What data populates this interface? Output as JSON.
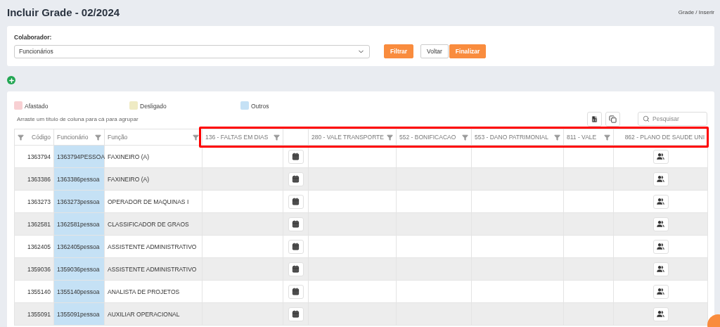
{
  "page": {
    "title": "Incluir Grade - 02/2024",
    "breadcrumb": "Grade / Inserir"
  },
  "filter": {
    "label": "Colaborador:",
    "value": "Funcionários",
    "buttons": [
      {
        "label": "Filtrar",
        "kind": "primary"
      },
      {
        "label": "Voltar",
        "kind": "plain"
      },
      {
        "label": "Finalizar",
        "kind": "primary"
      }
    ]
  },
  "legend": [
    {
      "label": "Afastado",
      "color": "#f8d0d3"
    },
    {
      "label": "Desligado",
      "color": "#efebc4"
    },
    {
      "label": "Outros",
      "color": "#c5e1f5"
    }
  ],
  "group_hint": "Arraste um título de coluna para cá para agrupar",
  "search": {
    "placeholder": "Pesquisar"
  },
  "columns": [
    {
      "label": "Código",
      "kind": "code",
      "filterable": true
    },
    {
      "label": "Funcionário",
      "kind": "employee",
      "filterable": true
    },
    {
      "label": "Função",
      "kind": "role",
      "filterable": true
    },
    {
      "label": "136 - FALTAS EM DIAS",
      "kind": "empty",
      "filterable": true
    },
    {
      "kind": "calendar",
      "filterable": false
    },
    {
      "label": "280 - VALE TRANSPORTE",
      "kind": "empty",
      "filterable": true
    },
    {
      "label": "552 - BONIFICACAO",
      "kind": "empty",
      "filterable": true
    },
    {
      "label": "553 - DANO PATRIMONIAL",
      "kind": "empty",
      "filterable": true
    },
    {
      "label": "811 - VALE",
      "kind": "empty",
      "filterable": true
    },
    {
      "label": "862 - PLANO DE SAUDE UNI",
      "kind": "group",
      "filterable": false
    }
  ],
  "rows": [
    {
      "code": "1363794",
      "employee": "1363794PESSOA",
      "role": "FAXINEIRO (A)"
    },
    {
      "code": "1363386",
      "employee": "1363386pessoa",
      "role": "FAXINEIRO (A)"
    },
    {
      "code": "1363273",
      "employee": "1363273pessoa",
      "role": "OPERADOR DE MAQUINAS I"
    },
    {
      "code": "1362581",
      "employee": "1362581pessoa",
      "role": "CLASSIFICADOR DE GRAOS"
    },
    {
      "code": "1362405",
      "employee": "1362405pessoa",
      "role": "ASSISTENTE ADMINISTRATIVO"
    },
    {
      "code": "1359036",
      "employee": "1359036pessoa",
      "role": "ASSISTENTE ADMINISTRATIVO"
    },
    {
      "code": "1355140",
      "employee": "1355140pessoa",
      "role": "ANALISTA DE PROJETOS"
    },
    {
      "code": "1355091",
      "employee": "1355091pessoa",
      "role": "AUXILIAR OPERACIONAL"
    }
  ]
}
